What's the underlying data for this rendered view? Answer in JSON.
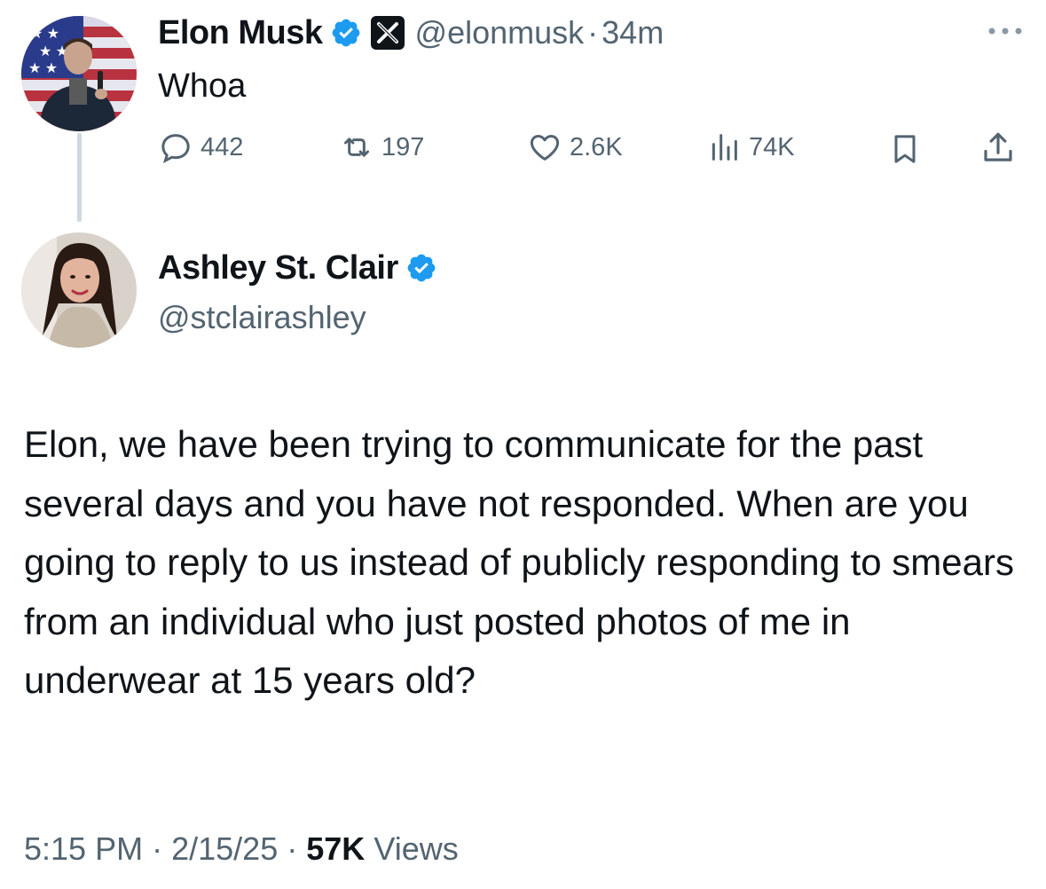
{
  "reply": {
    "author_name": "Elon Musk",
    "handle": "@elonmusk",
    "separator": "·",
    "time_ago": "34m",
    "text": "Whoa",
    "metrics": {
      "replies": "442",
      "reposts": "197",
      "likes": "2.6K",
      "views": "74K"
    }
  },
  "main": {
    "author_name": "Ashley St. Clair",
    "handle": "@stclairashley",
    "text": "Elon, we have been trying to communicate for the past several days and you have not responded. When are you going to reply to us instead of publicly responding to smears from an individual who just posted photos of me in underwear at 15 years old?",
    "time": "5:15 PM",
    "date": "2/15/25",
    "sep": "·",
    "views_count": "57K",
    "views_label": "Views"
  },
  "icons": {
    "verified": "verified-badge-icon",
    "x_logo": "x-logo-icon",
    "more": "more-dots-icon",
    "reply": "reply-icon",
    "repost": "repost-icon",
    "like": "heart-icon",
    "views": "views-bar-icon",
    "bookmark": "bookmark-icon",
    "share": "share-icon"
  },
  "colors": {
    "verified_blue": "#1d9bf0",
    "secondary_text": "#536471",
    "primary_text": "#0f1419"
  }
}
